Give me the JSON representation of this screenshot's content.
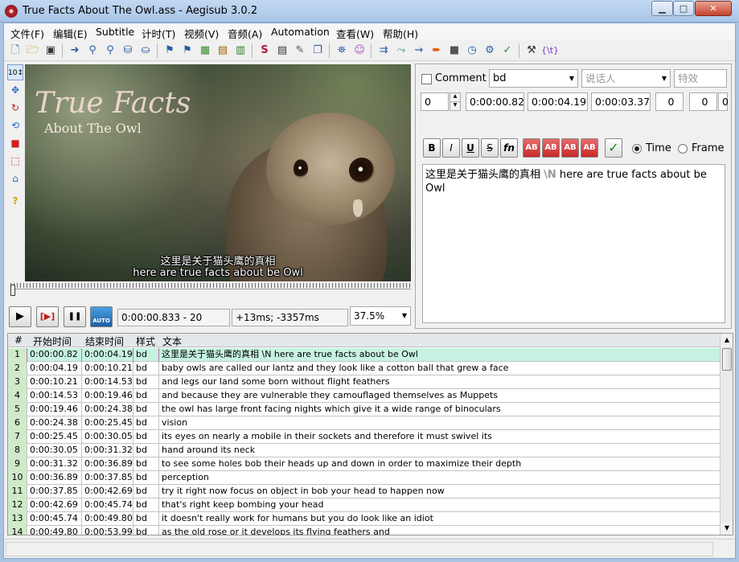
{
  "window": {
    "title": "True Facts About The Owl.ass - Aegisub 3.0.2",
    "min_label": "▁",
    "max_label": "□",
    "close_label": "✕"
  },
  "menu": [
    "文件(F)",
    "编辑(E)",
    "Subtitle",
    "计时(T)",
    "视频(V)",
    "音频(A)",
    "Automation",
    "查看(W)",
    "帮助(H)"
  ],
  "toolbar": {
    "icons": [
      "new-file-icon",
      "open-file-icon",
      "save-icon",
      "jump-to-icon",
      "zoom-in-icon",
      "zoom-out-icon",
      "jump-video-icon",
      "snap-icon",
      "bookmark-blue-icon",
      "bookmark-red-icon",
      "shift-icon",
      "keyframes-icon",
      "frames-icon",
      "styles-icon",
      "properties-icon",
      "attachments-icon",
      "fonts-icon",
      "translation-icon",
      "resample-icon",
      "spell-icon",
      "timing-icon",
      "kanji-icon",
      "automation-icon",
      "clock-icon",
      "select-icon",
      "check-icon",
      "tools-icon",
      "tag-icon"
    ],
    "tag_text": "{\\t}"
  },
  "vtools": [
    "standard-cursor-icon",
    "drag-icon",
    "rotate-z-icon",
    "rotate-xy-icon",
    "scale-icon",
    "clip-icon",
    "vector-clip-icon",
    "help-icon"
  ],
  "video": {
    "logo_line1": "True Facts",
    "logo_line2": "About The Owl",
    "sub_line1": "这里是关于猫头鹰的真相",
    "sub_line2": "here are true facts about be Owl"
  },
  "playback": {
    "play": "▶",
    "play_line": "[▶]",
    "stop": "❚❚",
    "auto_label": "AUTO",
    "time_frame": "0:00:00.833 - 20",
    "offset": "+13ms; -3357ms",
    "zoom": "37.5%"
  },
  "edit": {
    "comment_label": "Comment",
    "style": "bd",
    "actor_placeholder": "说话人",
    "effect_placeholder": "特效",
    "layer": "0",
    "start": "0:00:00.82",
    "end": "0:00:04.19",
    "duration": "0:00:03.37",
    "margin_l": "0",
    "margin_r": "0",
    "margin_v": "0",
    "format_buttons": [
      "B",
      "I",
      "U",
      "S",
      "fn",
      "AB",
      "AB",
      "AB",
      "AB",
      "✓"
    ],
    "time_label": "Time",
    "frame_label": "Frame",
    "text_cn": "这里是关于猫头鹰的真相 ",
    "text_tag": "\\N",
    "text_en": " here are true facts about be Owl"
  },
  "grid": {
    "headers": [
      "#",
      "开始时间",
      "结束时间",
      "样式",
      "文本"
    ],
    "rows": [
      {
        "n": "1",
        "start": "0:00:00.82",
        "end": "0:00:04.19",
        "style": "bd",
        "text": "这里是关于猫头鹰的真相 \\N here are true facts about be Owl"
      },
      {
        "n": "2",
        "start": "0:00:04.19",
        "end": "0:00:10.21",
        "style": "bd",
        "text": "baby owls are called our lantz and they look like a cotton ball that grew a face"
      },
      {
        "n": "3",
        "start": "0:00:10.21",
        "end": "0:00:14.53",
        "style": "bd",
        "text": "and legs our land some born without flight feathers"
      },
      {
        "n": "4",
        "start": "0:00:14.53",
        "end": "0:00:19.46",
        "style": "bd",
        "text": "and because they are vulnerable they camouflaged themselves as Muppets"
      },
      {
        "n": "5",
        "start": "0:00:19.46",
        "end": "0:00:24.38",
        "style": "bd",
        "text": "the owl has large front facing nights which give it a wide range of binoculars"
      },
      {
        "n": "6",
        "start": "0:00:24.38",
        "end": "0:00:25.45",
        "style": "bd",
        "text": "vision"
      },
      {
        "n": "7",
        "start": "0:00:25.45",
        "end": "0:00:30.05",
        "style": "bd",
        "text": "its eyes on nearly a mobile in their sockets and therefore it must swivel its"
      },
      {
        "n": "8",
        "start": "0:00:30.05",
        "end": "0:00:31.32",
        "style": "bd",
        "text": "hand around its neck"
      },
      {
        "n": "9",
        "start": "0:00:31.32",
        "end": "0:00:36.89",
        "style": "bd",
        "text": "to see some holes bob their heads up and down in order to maximize their depth"
      },
      {
        "n": "10",
        "start": "0:00:36.89",
        "end": "0:00:37.85",
        "style": "bd",
        "text": "perception"
      },
      {
        "n": "11",
        "start": "0:00:37.85",
        "end": "0:00:42.69",
        "style": "bd",
        "text": "try it right now focus on object in bob your head to happen now"
      },
      {
        "n": "12",
        "start": "0:00:42.69",
        "end": "0:00:45.74",
        "style": "bd",
        "text": "that's right keep bombing your head"
      },
      {
        "n": "13",
        "start": "0:00:45.74",
        "end": "0:00:49.80",
        "style": "bd",
        "text": "it doesn't really work for humans but you do look like an idiot"
      },
      {
        "n": "14",
        "start": "0:00:49.80",
        "end": "0:00:53.99",
        "style": "bd",
        "text": "as the old rose or it develops its flying feathers and"
      }
    ]
  }
}
